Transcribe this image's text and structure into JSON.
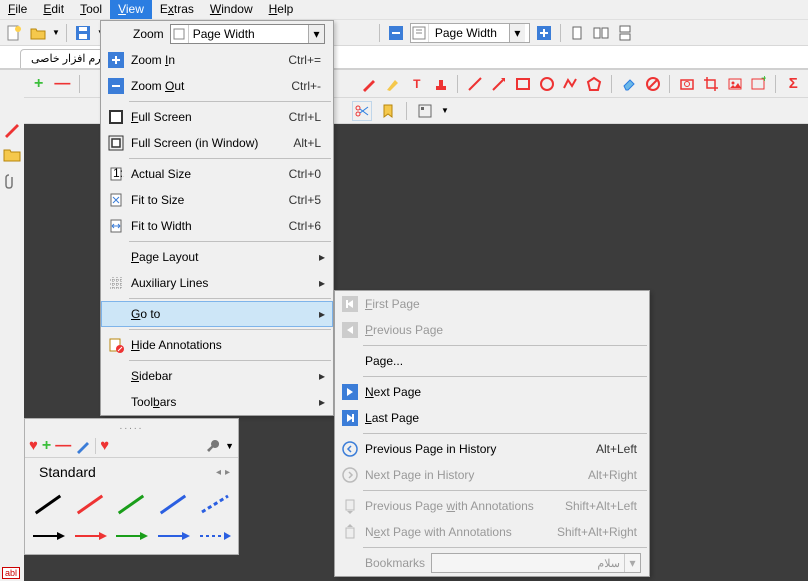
{
  "menubar": {
    "file": "File",
    "edit": "Edit",
    "tool": "Tool",
    "view": "View",
    "extras": "Extras",
    "window": "Window",
    "help": "Help"
  },
  "toolbar": {
    "zoom_value": "Page Width",
    "zoom_value2": "Page Width"
  },
  "tab": {
    "title": "رم افزار خاصی"
  },
  "view_menu": {
    "zoom_label": "Zoom",
    "zoom_combo": "Page Width",
    "zoom_in": "Zoom In",
    "zoom_in_sc": "Ctrl+=",
    "zoom_out": "Zoom Out",
    "zoom_out_sc": "Ctrl+-",
    "full_screen": "Full Screen",
    "full_screen_sc": "Ctrl+L",
    "full_screen_win": "Full Screen (in Window)",
    "full_screen_win_sc": "Alt+L",
    "actual_size": "Actual Size",
    "actual_size_sc": "Ctrl+0",
    "fit_to_size": "Fit to Size",
    "fit_to_size_sc": "Ctrl+5",
    "fit_to_width": "Fit to Width",
    "fit_to_width_sc": "Ctrl+6",
    "page_layout": "Page Layout",
    "aux_lines": "Auxiliary Lines",
    "go_to": "Go to",
    "hide_ann": "Hide Annotations",
    "sidebar": "Sidebar",
    "toolbars": "Toolbars"
  },
  "goto_menu": {
    "first": "First Page",
    "prev": "Previous Page",
    "page": "Page...",
    "next": "Next Page",
    "last": "Last Page",
    "prev_hist": "Previous Page in History",
    "prev_hist_sc": "Alt+Left",
    "next_hist": "Next Page in History",
    "next_hist_sc": "Alt+Right",
    "prev_ann": "Previous Page with Annotations",
    "prev_ann_sc": "Shift+Alt+Left",
    "next_ann": "Next Page with Annotations",
    "next_ann_sc": "Shift+Alt+Right",
    "bookmarks": "Bookmarks",
    "bookmarks_value": "سلام"
  },
  "palette": {
    "title": "Standard",
    "dots": "....."
  }
}
